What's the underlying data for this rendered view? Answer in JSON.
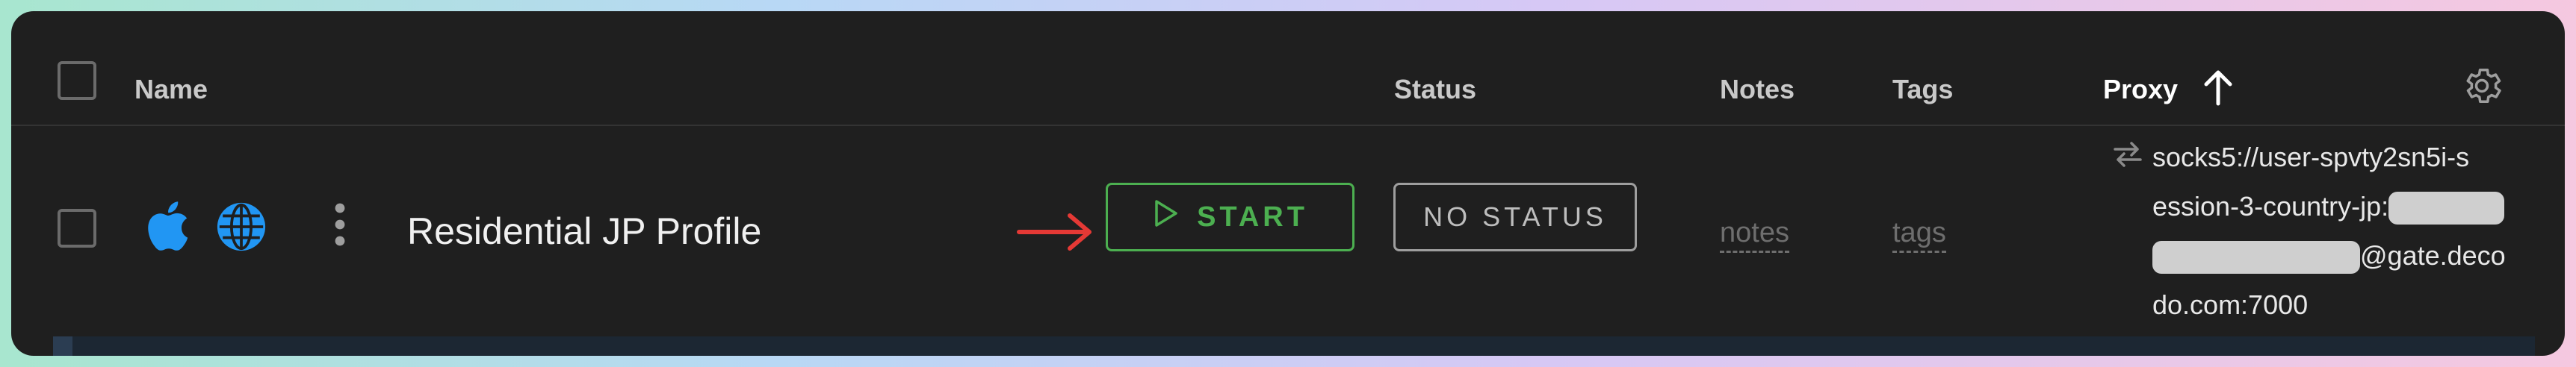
{
  "header": {
    "name_label": "Name",
    "status_label": "Status",
    "notes_label": "Notes",
    "tags_label": "Tags",
    "proxy_label": "Proxy"
  },
  "row": {
    "profile_name": "Residential JP Profile",
    "start_label": "START",
    "status_value": "NO STATUS",
    "notes_placeholder": "notes",
    "tags_placeholder": "tags",
    "proxy_line1": "socks5://user-spvty2sn5i-s",
    "proxy_line2": "ession-3-country-jp:",
    "proxy_line3_suffix": "@gate.deco",
    "proxy_line4": "do.com:7000"
  },
  "colors": {
    "accent_green": "#4caf50",
    "apple_blue": "#2196f3",
    "arrow_red": "#e53935"
  },
  "icons": [
    "apple-icon",
    "globe-icon",
    "more-vertical-icon",
    "play-icon",
    "arrow-up-icon",
    "gear-icon",
    "swap-icon",
    "arrow-right-icon"
  ]
}
